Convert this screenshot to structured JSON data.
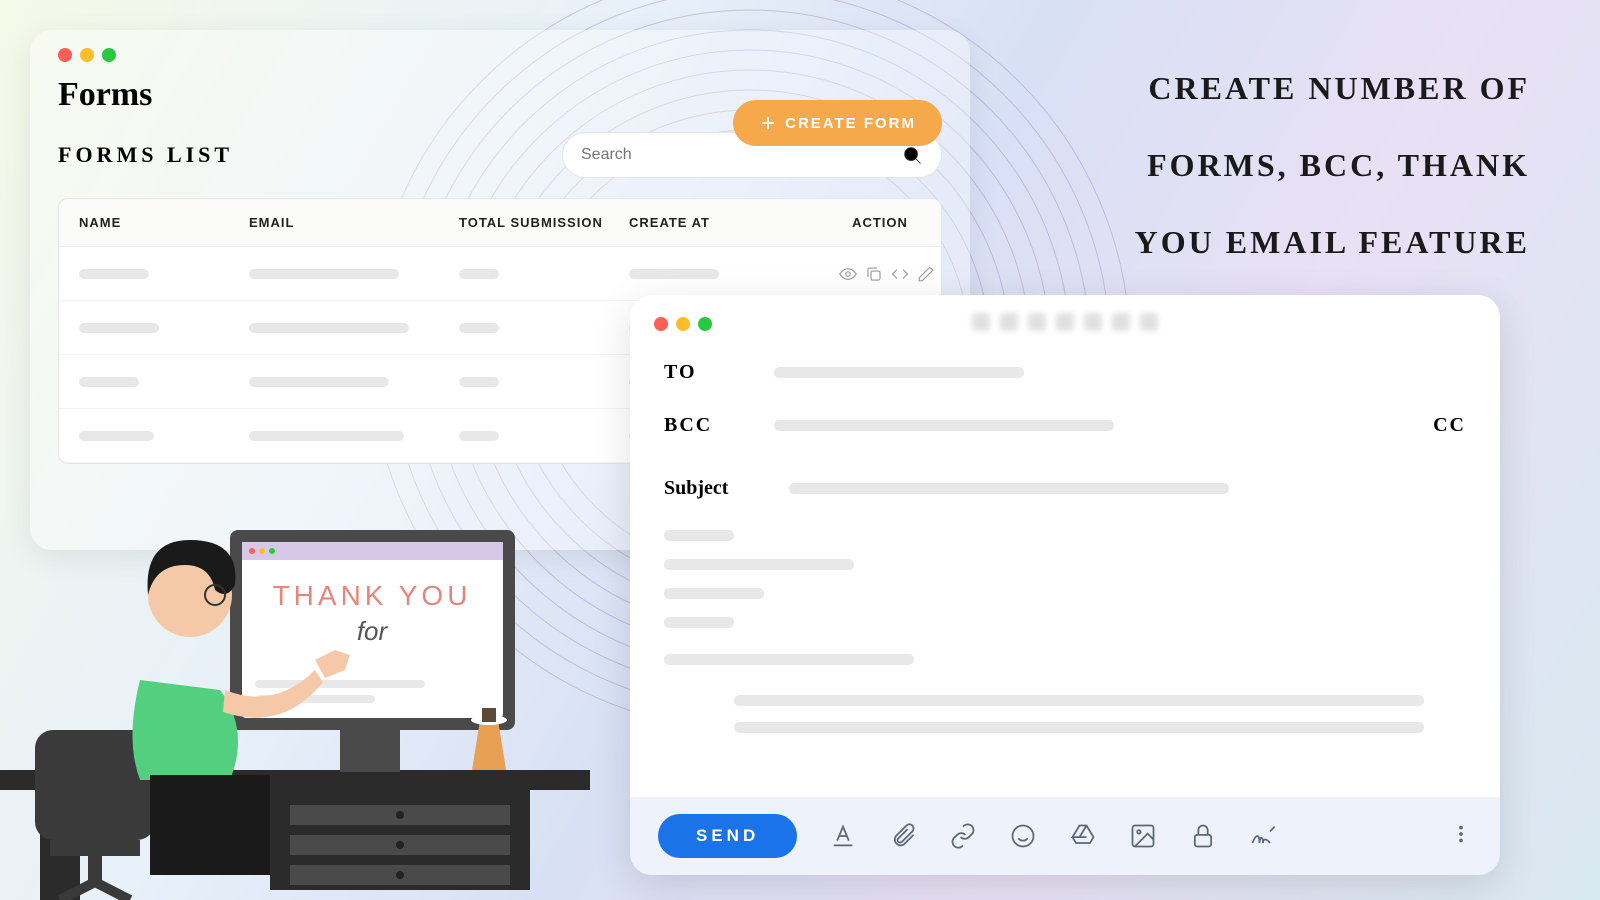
{
  "marketing_text": "CREATE NUMBER OF FORMS, BCC, THANK YOU EMAIL FEATURE",
  "forms": {
    "title": "Forms",
    "list_label": "FORMS LIST",
    "create_button": "CREATE FORM",
    "search_placeholder": "Search",
    "columns": {
      "name": "NAME",
      "email": "EMAIL",
      "total": "TOTAL SUBMISSION",
      "created": "CREATE AT",
      "action": "ACTION"
    },
    "action_icons": [
      "view-icon",
      "copy-icon",
      "code-icon",
      "edit-icon",
      "delete-icon",
      "duplicate-icon",
      "grid-icon"
    ]
  },
  "email": {
    "to_label": "TO",
    "bcc_label": "BCC",
    "cc_label": "CC",
    "subject_label": "Subject",
    "send_button": "SEND",
    "toolbar_icons": [
      "format-icon",
      "attach-icon",
      "link-icon",
      "emoji-icon",
      "drive-icon",
      "image-icon",
      "lock-icon",
      "signature-icon"
    ]
  },
  "thankyou": {
    "line1": "THANK YOU",
    "line2": "for"
  }
}
